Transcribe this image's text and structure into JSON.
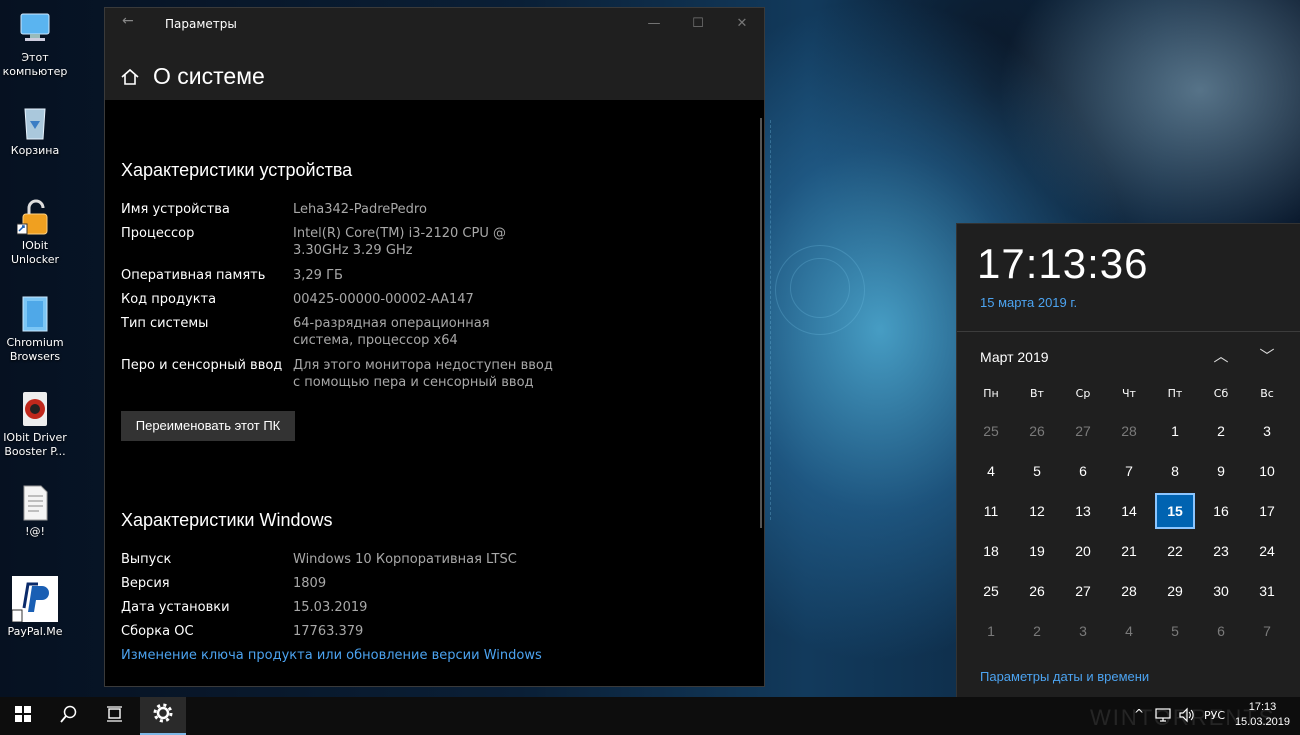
{
  "desktop": {
    "icons": [
      {
        "label": "Этот компьютер",
        "icon": "computer-icon"
      },
      {
        "label": "Корзина",
        "icon": "recycle-bin-icon"
      },
      {
        "label": "IObit Unlocker",
        "icon": "unlocker-icon"
      },
      {
        "label": "Chromium Browsers",
        "icon": "folder-icon"
      },
      {
        "label": "IObit Driver Booster P...",
        "icon": "driver-booster-icon"
      },
      {
        "label": "!@!",
        "icon": "text-file-icon"
      },
      {
        "label": "PayPal.Me",
        "icon": "paypal-icon"
      }
    ]
  },
  "window": {
    "title": "Параметры",
    "back_icon": "back-arrow-icon",
    "page_title": "О системе",
    "device_section": {
      "heading": "Характеристики устройства",
      "rows": [
        {
          "key": "Имя устройства",
          "value": "Leha342-PadrePedro"
        },
        {
          "key": "Процессор",
          "value": "Intel(R) Core(TM) i3-2120 CPU @ 3.30GHz 3.29 GHz"
        },
        {
          "key": "Оперативная память",
          "value": "3,29 ГБ"
        },
        {
          "key": "Код продукта",
          "value": "00425-00000-00002-AA147"
        },
        {
          "key": "Тип системы",
          "value": "64-разрядная операционная система, процессор x64"
        },
        {
          "key": "Перо и сенсорный ввод",
          "value": "Для этого монитора недоступен ввод с помощью пера и сенсорный ввод"
        }
      ],
      "rename_button": "Переименовать этот ПК"
    },
    "windows_section": {
      "heading": "Характеристики Windows",
      "rows": [
        {
          "key": "Выпуск",
          "value": "Windows 10 Корпоративная LTSC"
        },
        {
          "key": "Версия",
          "value": "1809"
        },
        {
          "key": "Дата установки",
          "value": "15.03.2019"
        },
        {
          "key": "Сборка ОС",
          "value": "17763.379"
        }
      ],
      "link": "Изменение ключа продукта или обновление версии Windows"
    }
  },
  "flyout": {
    "time": "17:13:36",
    "date": "15 марта 2019 г.",
    "month_label": "Март 2019",
    "weekdays": [
      "Пн",
      "Вт",
      "Ср",
      "Чт",
      "Пт",
      "Сб",
      "Вс"
    ],
    "weeks": [
      [
        "25",
        "26",
        "27",
        "28",
        "1",
        "2",
        "3"
      ],
      [
        "4",
        "5",
        "6",
        "7",
        "8",
        "9",
        "10"
      ],
      [
        "11",
        "12",
        "13",
        "14",
        "15",
        "16",
        "17"
      ],
      [
        "18",
        "19",
        "20",
        "21",
        "22",
        "23",
        "24"
      ],
      [
        "25",
        "26",
        "27",
        "28",
        "29",
        "30",
        "31"
      ],
      [
        "1",
        "2",
        "3",
        "4",
        "5",
        "6",
        "7"
      ]
    ],
    "today": "15",
    "settings_link": "Параметры даты и времени"
  },
  "taskbar": {
    "language": "РУС",
    "time": "17:13",
    "date": "15.03.2019",
    "watermark": "WINTORRENTS"
  },
  "colors": {
    "accent": "#0063b1",
    "link": "#4ca3f0",
    "window_bg": "#000000",
    "titlebar_bg": "#1f1f1f"
  }
}
